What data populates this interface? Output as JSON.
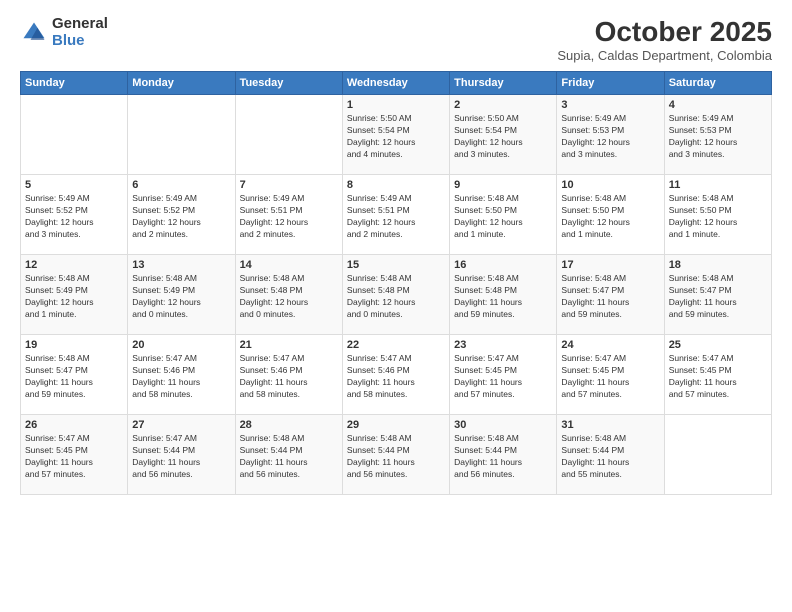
{
  "header": {
    "logo_general": "General",
    "logo_blue": "Blue",
    "month_title": "October 2025",
    "subtitle": "Supia, Caldas Department, Colombia"
  },
  "weekdays": [
    "Sunday",
    "Monday",
    "Tuesday",
    "Wednesday",
    "Thursday",
    "Friday",
    "Saturday"
  ],
  "weeks": [
    [
      {
        "day": "",
        "info": ""
      },
      {
        "day": "",
        "info": ""
      },
      {
        "day": "",
        "info": ""
      },
      {
        "day": "1",
        "info": "Sunrise: 5:50 AM\nSunset: 5:54 PM\nDaylight: 12 hours\nand 4 minutes."
      },
      {
        "day": "2",
        "info": "Sunrise: 5:50 AM\nSunset: 5:54 PM\nDaylight: 12 hours\nand 3 minutes."
      },
      {
        "day": "3",
        "info": "Sunrise: 5:49 AM\nSunset: 5:53 PM\nDaylight: 12 hours\nand 3 minutes."
      },
      {
        "day": "4",
        "info": "Sunrise: 5:49 AM\nSunset: 5:53 PM\nDaylight: 12 hours\nand 3 minutes."
      }
    ],
    [
      {
        "day": "5",
        "info": "Sunrise: 5:49 AM\nSunset: 5:52 PM\nDaylight: 12 hours\nand 3 minutes."
      },
      {
        "day": "6",
        "info": "Sunrise: 5:49 AM\nSunset: 5:52 PM\nDaylight: 12 hours\nand 2 minutes."
      },
      {
        "day": "7",
        "info": "Sunrise: 5:49 AM\nSunset: 5:51 PM\nDaylight: 12 hours\nand 2 minutes."
      },
      {
        "day": "8",
        "info": "Sunrise: 5:49 AM\nSunset: 5:51 PM\nDaylight: 12 hours\nand 2 minutes."
      },
      {
        "day": "9",
        "info": "Sunrise: 5:48 AM\nSunset: 5:50 PM\nDaylight: 12 hours\nand 1 minute."
      },
      {
        "day": "10",
        "info": "Sunrise: 5:48 AM\nSunset: 5:50 PM\nDaylight: 12 hours\nand 1 minute."
      },
      {
        "day": "11",
        "info": "Sunrise: 5:48 AM\nSunset: 5:50 PM\nDaylight: 12 hours\nand 1 minute."
      }
    ],
    [
      {
        "day": "12",
        "info": "Sunrise: 5:48 AM\nSunset: 5:49 PM\nDaylight: 12 hours\nand 1 minute."
      },
      {
        "day": "13",
        "info": "Sunrise: 5:48 AM\nSunset: 5:49 PM\nDaylight: 12 hours\nand 0 minutes."
      },
      {
        "day": "14",
        "info": "Sunrise: 5:48 AM\nSunset: 5:48 PM\nDaylight: 12 hours\nand 0 minutes."
      },
      {
        "day": "15",
        "info": "Sunrise: 5:48 AM\nSunset: 5:48 PM\nDaylight: 12 hours\nand 0 minutes."
      },
      {
        "day": "16",
        "info": "Sunrise: 5:48 AM\nSunset: 5:48 PM\nDaylight: 11 hours\nand 59 minutes."
      },
      {
        "day": "17",
        "info": "Sunrise: 5:48 AM\nSunset: 5:47 PM\nDaylight: 11 hours\nand 59 minutes."
      },
      {
        "day": "18",
        "info": "Sunrise: 5:48 AM\nSunset: 5:47 PM\nDaylight: 11 hours\nand 59 minutes."
      }
    ],
    [
      {
        "day": "19",
        "info": "Sunrise: 5:48 AM\nSunset: 5:47 PM\nDaylight: 11 hours\nand 59 minutes."
      },
      {
        "day": "20",
        "info": "Sunrise: 5:47 AM\nSunset: 5:46 PM\nDaylight: 11 hours\nand 58 minutes."
      },
      {
        "day": "21",
        "info": "Sunrise: 5:47 AM\nSunset: 5:46 PM\nDaylight: 11 hours\nand 58 minutes."
      },
      {
        "day": "22",
        "info": "Sunrise: 5:47 AM\nSunset: 5:46 PM\nDaylight: 11 hours\nand 58 minutes."
      },
      {
        "day": "23",
        "info": "Sunrise: 5:47 AM\nSunset: 5:45 PM\nDaylight: 11 hours\nand 57 minutes."
      },
      {
        "day": "24",
        "info": "Sunrise: 5:47 AM\nSunset: 5:45 PM\nDaylight: 11 hours\nand 57 minutes."
      },
      {
        "day": "25",
        "info": "Sunrise: 5:47 AM\nSunset: 5:45 PM\nDaylight: 11 hours\nand 57 minutes."
      }
    ],
    [
      {
        "day": "26",
        "info": "Sunrise: 5:47 AM\nSunset: 5:45 PM\nDaylight: 11 hours\nand 57 minutes."
      },
      {
        "day": "27",
        "info": "Sunrise: 5:47 AM\nSunset: 5:44 PM\nDaylight: 11 hours\nand 56 minutes."
      },
      {
        "day": "28",
        "info": "Sunrise: 5:48 AM\nSunset: 5:44 PM\nDaylight: 11 hours\nand 56 minutes."
      },
      {
        "day": "29",
        "info": "Sunrise: 5:48 AM\nSunset: 5:44 PM\nDaylight: 11 hours\nand 56 minutes."
      },
      {
        "day": "30",
        "info": "Sunrise: 5:48 AM\nSunset: 5:44 PM\nDaylight: 11 hours\nand 56 minutes."
      },
      {
        "day": "31",
        "info": "Sunrise: 5:48 AM\nSunset: 5:44 PM\nDaylight: 11 hours\nand 55 minutes."
      },
      {
        "day": "",
        "info": ""
      }
    ]
  ]
}
